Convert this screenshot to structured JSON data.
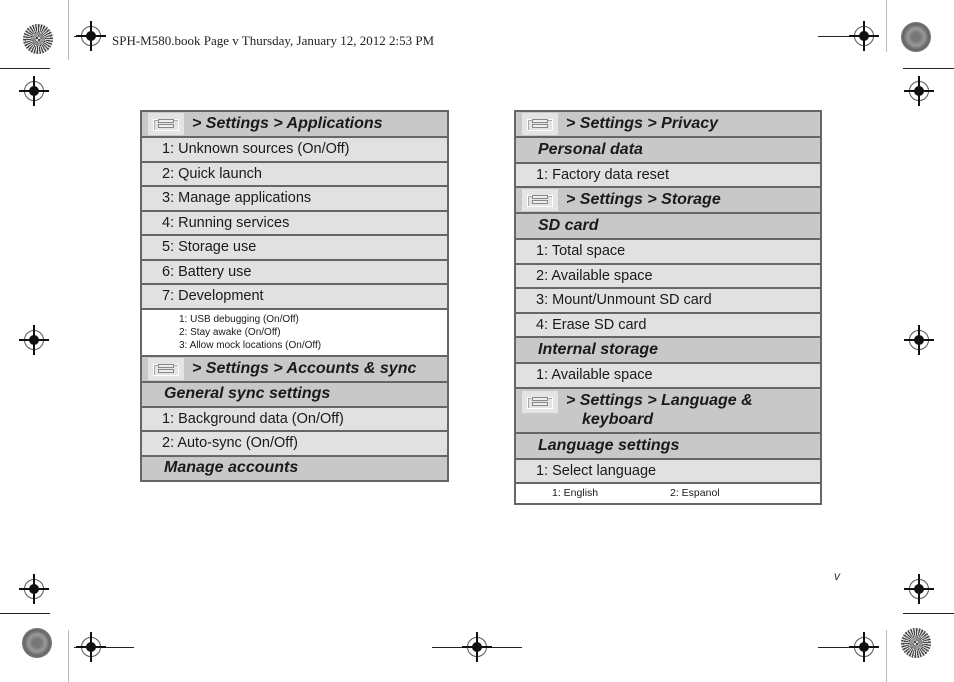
{
  "header": {
    "running_head": "SPH-M580.book  Page v  Thursday, January 12, 2012  2:53 PM"
  },
  "page_number": "v",
  "left_table": {
    "applications": {
      "title": "> Settings > Applications",
      "items": [
        "1: Unknown sources (On/Off)",
        "2: Quick launch",
        "3: Manage applications",
        "4: Running services",
        "5: Storage use",
        "6: Battery use",
        "7: Development"
      ],
      "development_sub": [
        "1: USB debugging (On/Off)",
        "2: Stay awake (On/Off)",
        "3: Allow mock locations (On/Off)"
      ]
    },
    "accounts": {
      "title": "> Settings > Accounts & sync",
      "general_sync_label": "General sync settings",
      "items": [
        "1: Background data (On/Off)",
        "2: Auto-sync (On/Off)"
      ],
      "manage_accounts_label": "Manage accounts"
    }
  },
  "right_table": {
    "privacy": {
      "title": "> Settings > Privacy",
      "section": "Personal data",
      "items": [
        "1: Factory data reset"
      ]
    },
    "storage": {
      "title": "> Settings > Storage",
      "sd_section": "SD card",
      "sd_items": [
        "1: Total space",
        "2: Available space",
        "3: Mount/Unmount SD card",
        "4: Erase SD card"
      ],
      "internal_section": "Internal storage",
      "internal_items": [
        "1: Available space"
      ]
    },
    "language": {
      "title_line1": "> Settings > Language &",
      "title_line2": "keyboard",
      "section": "Language settings",
      "items": [
        "1: Select language"
      ],
      "options": [
        "1: English",
        "2: Espanol"
      ]
    }
  }
}
